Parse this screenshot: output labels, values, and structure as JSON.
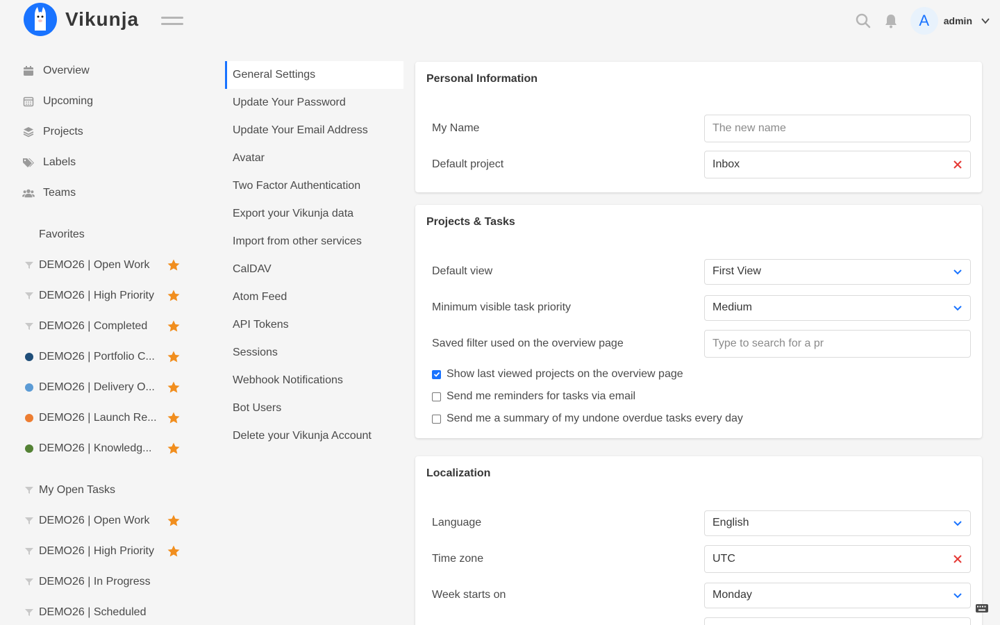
{
  "app": {
    "name": "Vikunja"
  },
  "header": {
    "username": "admin",
    "avatar_letter": "A"
  },
  "sidebar": {
    "nav": [
      {
        "label": "Overview",
        "icon": "calendar-icon"
      },
      {
        "label": "Upcoming",
        "icon": "calendar-grid-icon"
      },
      {
        "label": "Projects",
        "icon": "layers-icon"
      },
      {
        "label": "Labels",
        "icon": "tags-icon"
      },
      {
        "label": "Teams",
        "icon": "users-icon"
      }
    ],
    "favorites_title": "Favorites",
    "favorites": [
      {
        "name": "DEMO26 | Open Work",
        "marker": "filter",
        "color": ""
      },
      {
        "name": "DEMO26 | High Priority",
        "marker": "filter",
        "color": ""
      },
      {
        "name": "DEMO26 | Completed",
        "marker": "filter",
        "color": ""
      },
      {
        "name": "DEMO26 | Portfolio C...",
        "marker": "dot",
        "color": "#1f4e79"
      },
      {
        "name": "DEMO26 | Delivery O...",
        "marker": "dot",
        "color": "#5b9bd5"
      },
      {
        "name": "DEMO26 | Launch Re...",
        "marker": "dot",
        "color": "#ed7d31"
      },
      {
        "name": "DEMO26 | Knowledg...",
        "marker": "dot",
        "color": "#548235"
      }
    ],
    "my_open_tasks": "My Open Tasks",
    "more": [
      {
        "name": "DEMO26 | Open Work",
        "starred": true
      },
      {
        "name": "DEMO26 | High Priority",
        "starred": true
      },
      {
        "name": "DEMO26 | In Progress",
        "starred": false
      },
      {
        "name": "DEMO26 | Scheduled",
        "starred": false
      }
    ]
  },
  "settings_nav": [
    "General Settings",
    "Update Your Password",
    "Update Your Email Address",
    "Avatar",
    "Two Factor Authentication",
    "Export your Vikunja data",
    "Import from other services",
    "CalDAV",
    "Atom Feed",
    "API Tokens",
    "Sessions",
    "Webhook Notifications",
    "Bot Users",
    "Delete your Vikunja Account"
  ],
  "personal": {
    "title": "Personal Information",
    "name_label": "My Name",
    "name_placeholder": "The new name",
    "default_project_label": "Default project",
    "default_project_value": "Inbox"
  },
  "projects_tasks": {
    "title": "Projects & Tasks",
    "default_view_label": "Default view",
    "default_view_value": "First View",
    "min_priority_label": "Minimum visible task priority",
    "min_priority_value": "Medium",
    "saved_filter_label": "Saved filter used on the overview page",
    "saved_filter_placeholder": "Type to search for a pr",
    "check_last_viewed": "Show last viewed projects on the overview page",
    "check_reminders": "Send me reminders for tasks via email",
    "check_summary": "Send me a summary of my undone overdue tasks every day"
  },
  "localization": {
    "title": "Localization",
    "language_label": "Language",
    "language_value": "English",
    "timezone_label": "Time zone",
    "timezone_value": "UTC",
    "week_label": "Week starts on",
    "week_value": "Monday"
  },
  "colors": {
    "accent": "#1973ff",
    "star": "#f18e1e",
    "clear": "#e53935"
  }
}
